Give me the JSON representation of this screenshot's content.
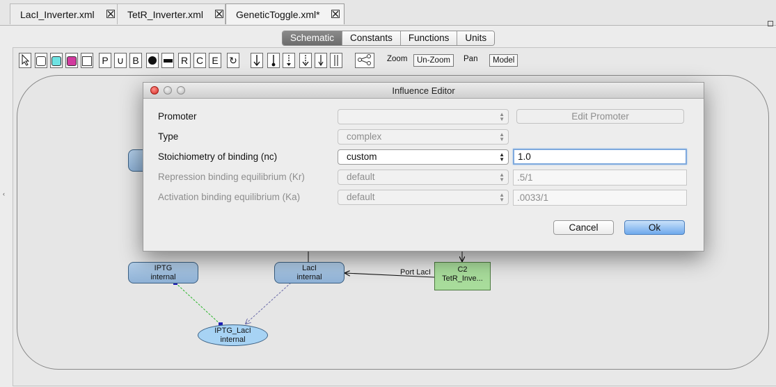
{
  "file_tabs": [
    {
      "label": "LacI_Inverter.xml",
      "active": false
    },
    {
      "label": "TetR_Inverter.xml",
      "active": false
    },
    {
      "label": "GeneticToggle.xml*",
      "active": true
    }
  ],
  "view_tabs": [
    {
      "label": "Schematic",
      "active": true
    },
    {
      "label": "Constants",
      "active": false
    },
    {
      "label": "Functions",
      "active": false
    },
    {
      "label": "Units",
      "active": false
    }
  ],
  "toolbar": {
    "letter_tools": [
      "P",
      "B",
      "R",
      "C",
      "E"
    ],
    "zoom_label": "Zoom",
    "unzoom_label": "Un-Zoom",
    "pan_label": "Pan",
    "model_label": "Model"
  },
  "canvas": {
    "nodes": {
      "iptg": {
        "line1": "IPTG",
        "line2": "internal"
      },
      "laci": {
        "line1": "LacI",
        "line2": "internal"
      },
      "iptg_laci": {
        "line1": "IPTG_LacI",
        "line2": "internal"
      },
      "c2": {
        "line1": "C2",
        "line2": "TetR_Inve..."
      }
    },
    "edge_label": "Port LacI"
  },
  "dialog": {
    "title": "Influence Editor",
    "promoter": {
      "label": "Promoter",
      "value": "",
      "button": "Edit Promoter"
    },
    "type": {
      "label": "Type",
      "value": "complex"
    },
    "stoichiometry": {
      "label": "Stoichiometry of binding (nc)",
      "select": "custom",
      "value": "1.0"
    },
    "repression": {
      "label": "Repression binding equilibrium (Kr)",
      "select": "default",
      "value": ".5/1"
    },
    "activation": {
      "label": "Activation binding equilibrium (Ka)",
      "select": "default",
      "value": ".0033/1"
    },
    "cancel_label": "Cancel",
    "ok_label": "Ok"
  }
}
